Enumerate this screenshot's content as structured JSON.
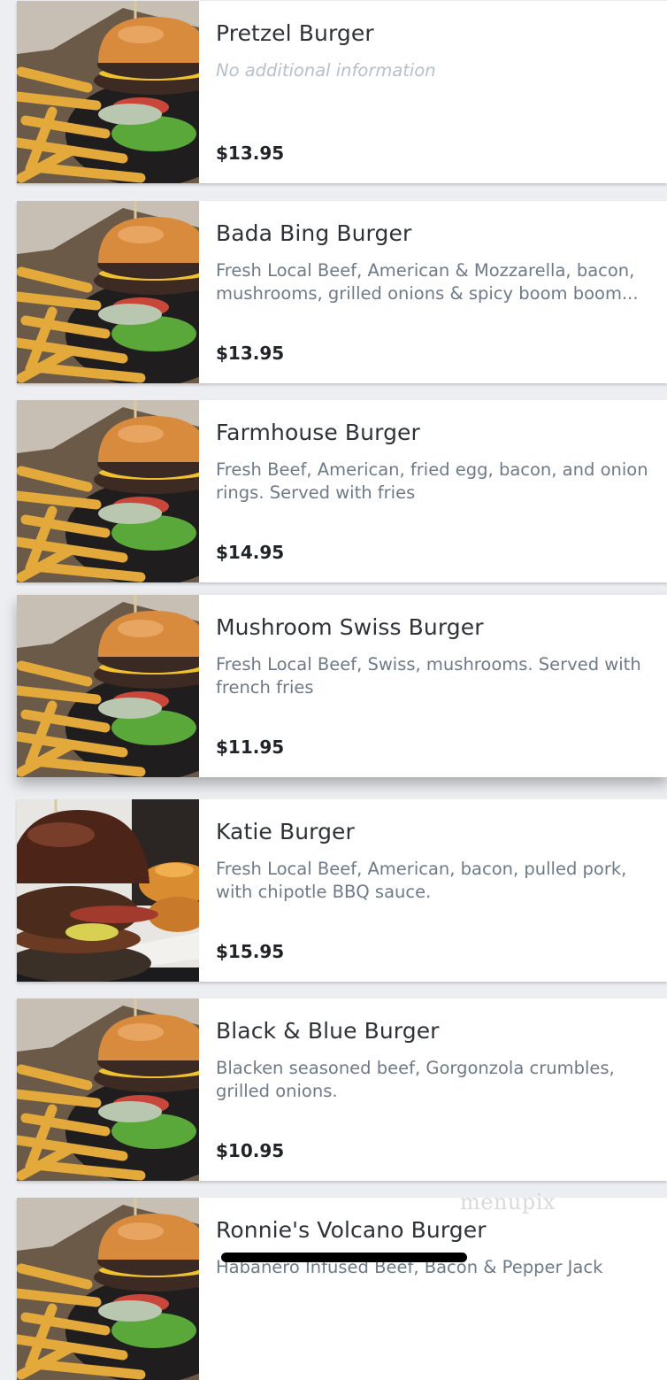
{
  "menu": {
    "items": [
      {
        "name": "Pretzel Burger",
        "description": "No additional information",
        "description_missing": true,
        "price": "$13.95",
        "image": "burger-fries-photo"
      },
      {
        "name": "Bada Bing Burger",
        "description": "Fresh Local Beef, American & Mozzarella, bacon, mushrooms, grilled onions & spicy boom boom...",
        "description_missing": false,
        "price": "$13.95",
        "image": "burger-fries-photo"
      },
      {
        "name": "Farmhouse Burger",
        "description": "Fresh Beef, American, fried egg, bacon, and onion rings. Served with fries",
        "description_missing": false,
        "price": "$14.95",
        "image": "burger-fries-photo"
      },
      {
        "name": "Mushroom Swiss Burger",
        "description": "Fresh Local Beef, Swiss, mushrooms. Served with french fries",
        "description_missing": false,
        "price": "$11.95",
        "image": "burger-fries-photo"
      },
      {
        "name": "Katie Burger",
        "description": "Fresh Local Beef, American, bacon, pulled pork, with chipotle BBQ sauce.",
        "description_missing": false,
        "price": "$15.95",
        "image": "pulled-pork-burger-photo"
      },
      {
        "name": "Black & Blue Burger",
        "description": "Blacken seasoned beef, Gorgonzola crumbles, grilled onions.",
        "description_missing": false,
        "price": "$10.95",
        "image": "burger-fries-photo"
      },
      {
        "name": "Ronnie's Volcano Burger",
        "description": "Habanero Infused Beef, Bacon & Pepper Jack",
        "description_missing": false,
        "price": "",
        "image": "burger-fries-photo"
      }
    ]
  },
  "watermark": "menupix",
  "colors": {
    "card_background": "#ffffff",
    "page_background": "#eceef1",
    "title_text": "#2f3338",
    "description_text": "#6e7a88",
    "missing_info_text": "#b7bfc8",
    "price_text": "#202327"
  }
}
